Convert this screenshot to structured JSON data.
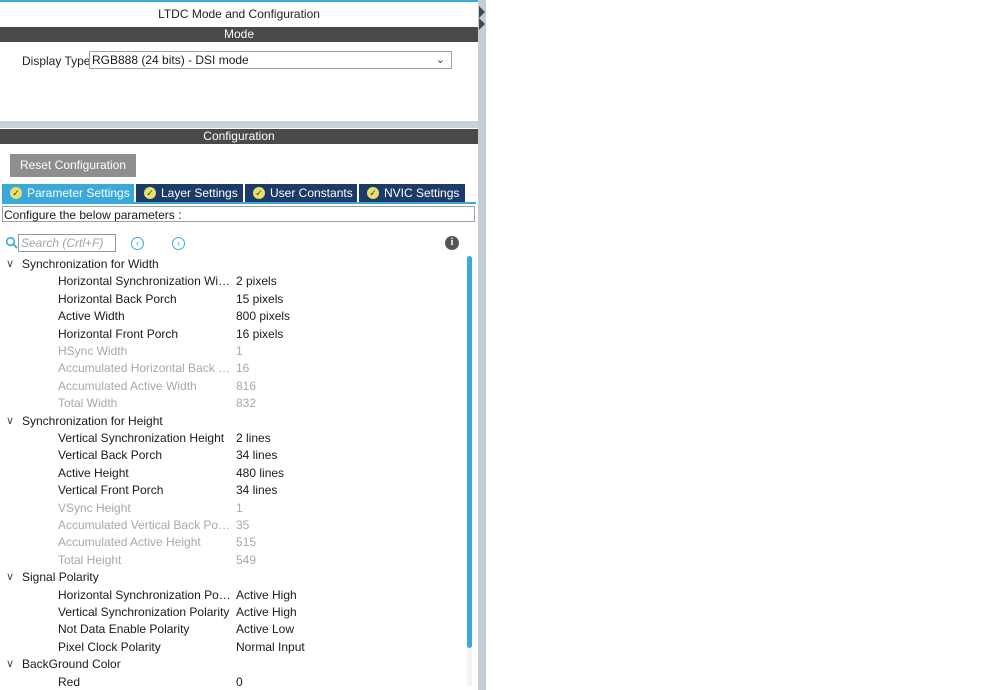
{
  "title": "LTDC Mode and Configuration",
  "mode": {
    "header": "Mode",
    "display_type_label": "Display Type",
    "display_type_value": "RGB888 (24 bits) - DSI mode"
  },
  "configuration": {
    "header": "Configuration",
    "reset_label": "Reset Configuration",
    "tabs": [
      {
        "label": "Parameter Settings",
        "active": true
      },
      {
        "label": "Layer Settings",
        "active": false
      },
      {
        "label": "User Constants",
        "active": false
      },
      {
        "label": "NVIC Settings",
        "active": false
      }
    ],
    "hint": "Configure the below parameters :",
    "search_placeholder": "Search (Crtl+F)",
    "icons": {
      "search": "search-icon",
      "prev": "chevron-left-circle-icon",
      "next": "chevron-right-circle-icon",
      "info": "info-icon",
      "group_toggle": "chevron-down-icon",
      "tab_check": "check-circle-icon"
    },
    "colors": {
      "accent": "#39a9dc",
      "tab_inactive": "#1d3a68",
      "section_header": "#4a4a4a",
      "disabled_text": "#a3a9ae"
    },
    "groups": [
      {
        "label": "Synchronization for Width",
        "params": [
          {
            "name": "Horizontal Synchronization Width",
            "value": "2 pixels",
            "disabled": false
          },
          {
            "name": "Horizontal Back Porch",
            "value": "15 pixels",
            "disabled": false
          },
          {
            "name": "Active Width",
            "value": "800 pixels",
            "disabled": false
          },
          {
            "name": "Horizontal Front Porch",
            "value": "16 pixels",
            "disabled": false
          },
          {
            "name": "HSync Width",
            "value": "1",
            "disabled": true
          },
          {
            "name": "Accumulated Horizontal Back P...",
            "value": "16",
            "disabled": true
          },
          {
            "name": "Accumulated Active Width",
            "value": "816",
            "disabled": true
          },
          {
            "name": "Total Width",
            "value": "832",
            "disabled": true
          }
        ]
      },
      {
        "label": "Synchronization for Height",
        "params": [
          {
            "name": "Vertical Synchronization Height",
            "value": "2 lines",
            "disabled": false
          },
          {
            "name": "Vertical Back Porch",
            "value": "34 lines",
            "disabled": false
          },
          {
            "name": "Active Height",
            "value": "480 lines",
            "disabled": false
          },
          {
            "name": "Vertical Front Porch",
            "value": "34 lines",
            "disabled": false
          },
          {
            "name": "VSync Height",
            "value": "1",
            "disabled": true
          },
          {
            "name": "Accumulated Vertical Back Porc...",
            "value": "35",
            "disabled": true
          },
          {
            "name": "Accumulated Active Height",
            "value": "515",
            "disabled": true
          },
          {
            "name": "Total Height",
            "value": "549",
            "disabled": true
          }
        ]
      },
      {
        "label": "Signal Polarity",
        "params": [
          {
            "name": "Horizontal Synchronization Polar...",
            "value": "Active High",
            "disabled": false
          },
          {
            "name": "Vertical Synchronization Polarity",
            "value": "Active High",
            "disabled": false
          },
          {
            "name": "Not Data Enable Polarity",
            "value": "Active Low",
            "disabled": false
          },
          {
            "name": "Pixel Clock Polarity",
            "value": "Normal Input",
            "disabled": false
          }
        ]
      },
      {
        "label": "BackGround Color",
        "params": [
          {
            "name": "Red",
            "value": "0",
            "disabled": false
          }
        ]
      }
    ]
  }
}
